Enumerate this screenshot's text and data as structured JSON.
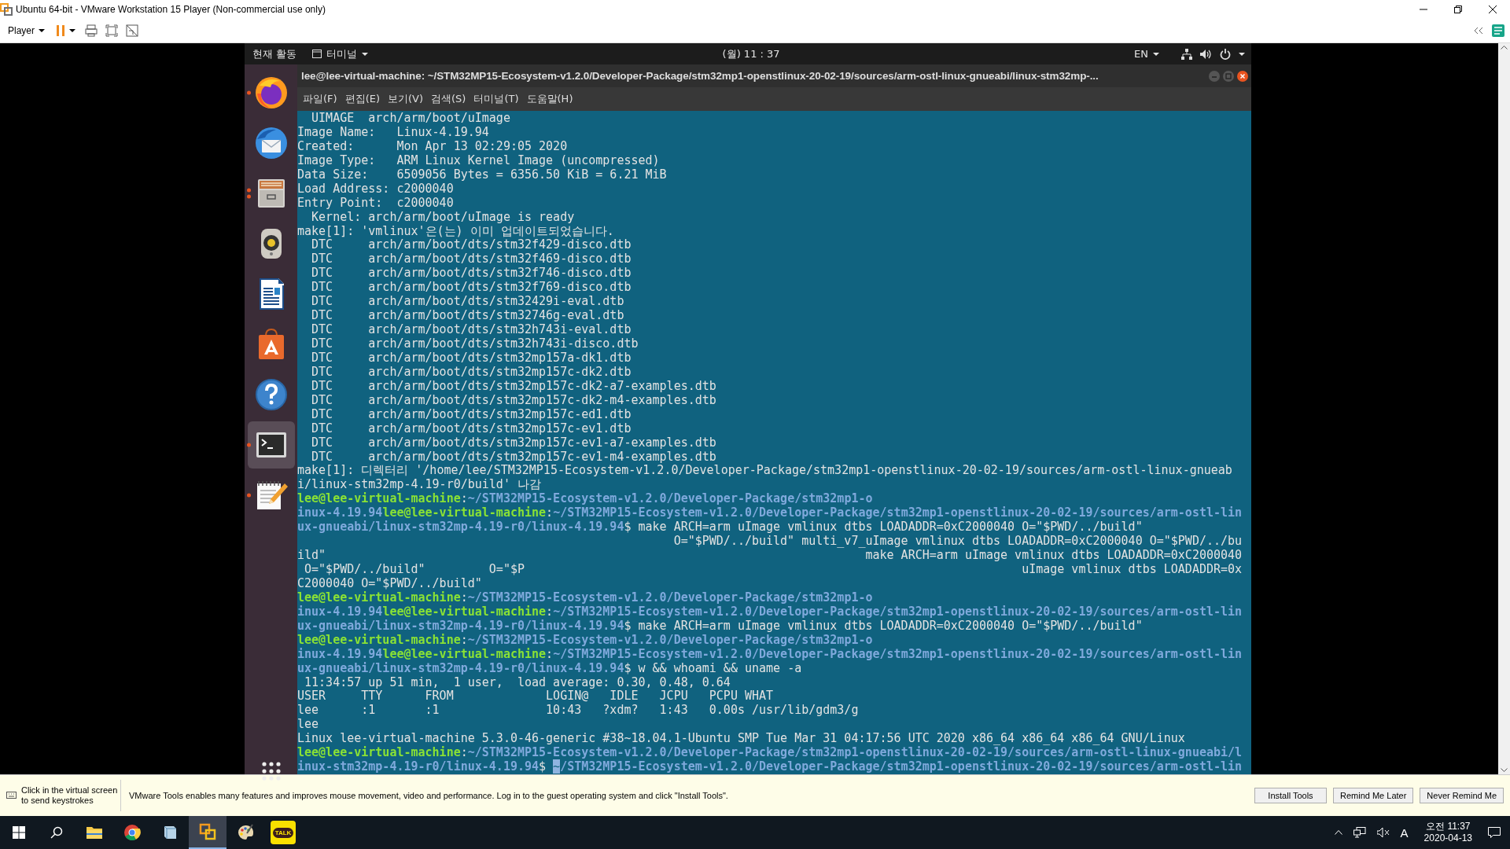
{
  "vmware": {
    "title": "Ubuntu 64-bit - VMware Workstation 15 Player (Non-commercial use only)",
    "player_menu": "Player"
  },
  "ubuntu_topbar": {
    "activities": "현재 활동",
    "app_menu": "터미널",
    "clock": "(월) 11 : 37",
    "input_method": "EN"
  },
  "dock": {
    "items": [
      {
        "kind": "firefox",
        "running": true,
        "selected": false
      },
      {
        "kind": "thunderbird",
        "running": false,
        "selected": false
      },
      {
        "kind": "files",
        "running": true,
        "multiple_windows": true,
        "selected": false
      },
      {
        "kind": "rhythmbox",
        "running": false,
        "selected": false
      },
      {
        "kind": "writer",
        "running": false,
        "selected": false
      },
      {
        "kind": "software",
        "running": false,
        "selected": false
      },
      {
        "kind": "help",
        "running": false,
        "selected": false
      },
      {
        "kind": "terminal",
        "running": true,
        "selected": true
      },
      {
        "kind": "editor",
        "running": true,
        "selected": false
      }
    ]
  },
  "terminal": {
    "title": "lee@lee-virtual-machine: ~/STM32MP15-Ecosystem-v1.2.0/Developer-Package/stm32mp1-openstlinux-20-02-19/sources/arm-ostl-linux-gnueabi/linux-stm32mp-...",
    "menu": [
      "파일(F)",
      "편집(E)",
      "보기(V)",
      "검색(S)",
      "터미널(T)",
      "도움말(H)"
    ],
    "lines": [
      "  UIMAGE  arch/arm/boot/uImage",
      "Image Name:   Linux-4.19.94",
      "Created:      Mon Apr 13 02:29:05 2020",
      "Image Type:   ARM Linux Kernel Image (uncompressed)",
      "Data Size:    6509056 Bytes = 6356.50 KiB = 6.21 MiB",
      "Load Address: c2000040",
      "Entry Point:  c2000040",
      "  Kernel: arch/arm/boot/uImage is ready",
      "make[1]: 'vmlinux'은(는) 이미 업데이트되었습니다.",
      "  DTC     arch/arm/boot/dts/stm32f429-disco.dtb",
      "  DTC     arch/arm/boot/dts/stm32f469-disco.dtb",
      "  DTC     arch/arm/boot/dts/stm32f746-disco.dtb",
      "  DTC     arch/arm/boot/dts/stm32f769-disco.dtb",
      "  DTC     arch/arm/boot/dts/stm32429i-eval.dtb",
      "  DTC     arch/arm/boot/dts/stm32746g-eval.dtb",
      "  DTC     arch/arm/boot/dts/stm32h743i-eval.dtb",
      "  DTC     arch/arm/boot/dts/stm32h743i-disco.dtb",
      "  DTC     arch/arm/boot/dts/stm32mp157a-dk1.dtb",
      "  DTC     arch/arm/boot/dts/stm32mp157c-dk2.dtb",
      "  DTC     arch/arm/boot/dts/stm32mp157c-dk2-a7-examples.dtb",
      "  DTC     arch/arm/boot/dts/stm32mp157c-dk2-m4-examples.dtb",
      "  DTC     arch/arm/boot/dts/stm32mp157c-ed1.dtb",
      "  DTC     arch/arm/boot/dts/stm32mp157c-ev1.dtb",
      "  DTC     arch/arm/boot/dts/stm32mp157c-ev1-a7-examples.dtb",
      "  DTC     arch/arm/boot/dts/stm32mp157c-ev1-m4-examples.dtb",
      "make[1]: 디렉터리 '/home/lee/STM32MP15-Ecosystem-v1.2.0/Developer-Package/stm32mp1-openstlinux-20-02-19/sources/arm-ostl-linux-gnueab",
      "i/linux-stm32mp-4.19-r0/build' 나감",
      [
        {
          "kind": "user",
          "text": "lee@lee-virtual-machine"
        },
        {
          "kind": "text",
          "text": ":"
        },
        {
          "kind": "path",
          "text": "~/STM32MP15-Ecosystem-v1.2.0/Developer-Package/stm32mp1-o"
        }
      ],
      [
        {
          "kind": "path",
          "text": "inux-4.19.94"
        },
        {
          "kind": "user",
          "text": "lee@lee-virtual-machine"
        },
        {
          "kind": "text",
          "text": ":"
        },
        {
          "kind": "path",
          "text": "~/STM32MP15-Ecosystem-v1.2.0/Developer-Package/stm32mp1-openstlinux-20-02-19/sources/arm-ostl-lin"
        }
      ],
      [
        {
          "kind": "path",
          "text": "ux-gnueabi/linux-stm32mp-4.19-r0/linux-4.19.94"
        },
        {
          "kind": "text",
          "text": "$ make ARCH=arm uImage vmlinux dtbs LOADADDR=0xC2000040 O=\"$PWD/../build\""
        }
      ],
      "                                                     O=\"$PWD/../build\" multi_v7_uImage vmlinux dtbs LOADADDR=0xC2000040 O=\"$PWD/../bu",
      "ild\"                                                                            make ARCH=arm uImage vmlinux dtbs LOADADDR=0xC2000040",
      " O=\"$PWD/../build\"         O=\"$P                                                                      uImage vmlinux dtbs LOADADDR=0x",
      "C2000040 O=\"$PWD/../build\"",
      [
        {
          "kind": "user",
          "text": "lee@lee-virtual-machine"
        },
        {
          "kind": "text",
          "text": ":"
        },
        {
          "kind": "path",
          "text": "~/STM32MP15-Ecosystem-v1.2.0/Developer-Package/stm32mp1-o"
        }
      ],
      [
        {
          "kind": "path",
          "text": "inux-4.19.94"
        },
        {
          "kind": "user",
          "text": "lee@lee-virtual-machine"
        },
        {
          "kind": "text",
          "text": ":"
        },
        {
          "kind": "path",
          "text": "~/STM32MP15-Ecosystem-v1.2.0/Developer-Package/stm32mp1-openstlinux-20-02-19/sources/arm-ostl-lin"
        }
      ],
      [
        {
          "kind": "path",
          "text": "ux-gnueabi/linux-stm32mp-4.19-r0/linux-4.19.94"
        },
        {
          "kind": "text",
          "text": "$ make ARCH=arm uImage vmlinux dtbs LOADADDR=0xC2000040 O=\"$PWD/../build\""
        }
      ],
      [
        {
          "kind": "user",
          "text": "lee@lee-virtual-machine"
        },
        {
          "kind": "text",
          "text": ":"
        },
        {
          "kind": "path",
          "text": "~/STM32MP15-Ecosystem-v1.2.0/Developer-Package/stm32mp1-o"
        }
      ],
      [
        {
          "kind": "path",
          "text": "inux-4.19.94"
        },
        {
          "kind": "user",
          "text": "lee@lee-virtual-machine"
        },
        {
          "kind": "text",
          "text": ":"
        },
        {
          "kind": "path",
          "text": "~/STM32MP15-Ecosystem-v1.2.0/Developer-Package/stm32mp1-openstlinux-20-02-19/sources/arm-ostl-lin"
        }
      ],
      [
        {
          "kind": "path",
          "text": "ux-gnueabi/linux-stm32mp-4.19-r0/linux-4.19.94"
        },
        {
          "kind": "text",
          "text": "$ w && whoami && uname -a"
        }
      ],
      " 11:34:57 up 51 min,  1 user,  load average: 0.30, 0.48, 0.64",
      "USER     TTY      FROM             LOGIN@   IDLE   JCPU   PCPU WHAT",
      "lee      :1       :1               10:43   ?xdm?   1:43   0.00s /usr/lib/gdm3/g",
      "lee",
      "Linux lee-virtual-machine 5.3.0-46-generic #38~18.04.1-Ubuntu SMP Tue Mar 31 04:17:56 UTC 2020 x86_64 x86_64 x86_64 GNU/Linux",
      [
        {
          "kind": "user",
          "text": "lee@lee-virtual-machine"
        },
        {
          "kind": "text",
          "text": ":"
        },
        {
          "kind": "path",
          "text": "~/STM32MP15-Ecosystem-v1.2.0/Developer-Package/stm32mp1-openstlinux-20-02-19/sources/arm-ostl-linux-gnueabi/l"
        }
      ],
      [
        {
          "kind": "path",
          "text": "inux-stm32mp-4.19-r0/linux-4.19.94"
        },
        {
          "kind": "text",
          "text": "$ "
        },
        {
          "kind": "cursor",
          "text": "~"
        },
        {
          "kind": "path",
          "text": "/STM32MP15-Ecosystem-v1.2.0/Developer-Package/stm32mp1-openstlinux-20-02-19/sources/arm-ostl-lin"
        }
      ]
    ]
  },
  "notification": {
    "hint": "Click in the virtual screen to send keystrokes",
    "message": "VMware Tools enables many features and improves mouse movement, video and performance. Log in to the guest operating system and click \"Install Tools\".",
    "buttons": [
      "Install Tools",
      "Remind Me Later",
      "Never Remind Me"
    ]
  },
  "taskbar": {
    "apps": [
      {
        "kind": "explorer",
        "active": false
      },
      {
        "kind": "chrome",
        "active": false
      },
      {
        "kind": "notebook",
        "active": false
      },
      {
        "kind": "vmware",
        "active": true
      },
      {
        "kind": "paint",
        "active": false
      },
      {
        "kind": "kakaotalk",
        "active": false,
        "label": "TALK"
      }
    ],
    "ime": "A",
    "time": "오전 11:37",
    "date": "2020-04-13"
  }
}
